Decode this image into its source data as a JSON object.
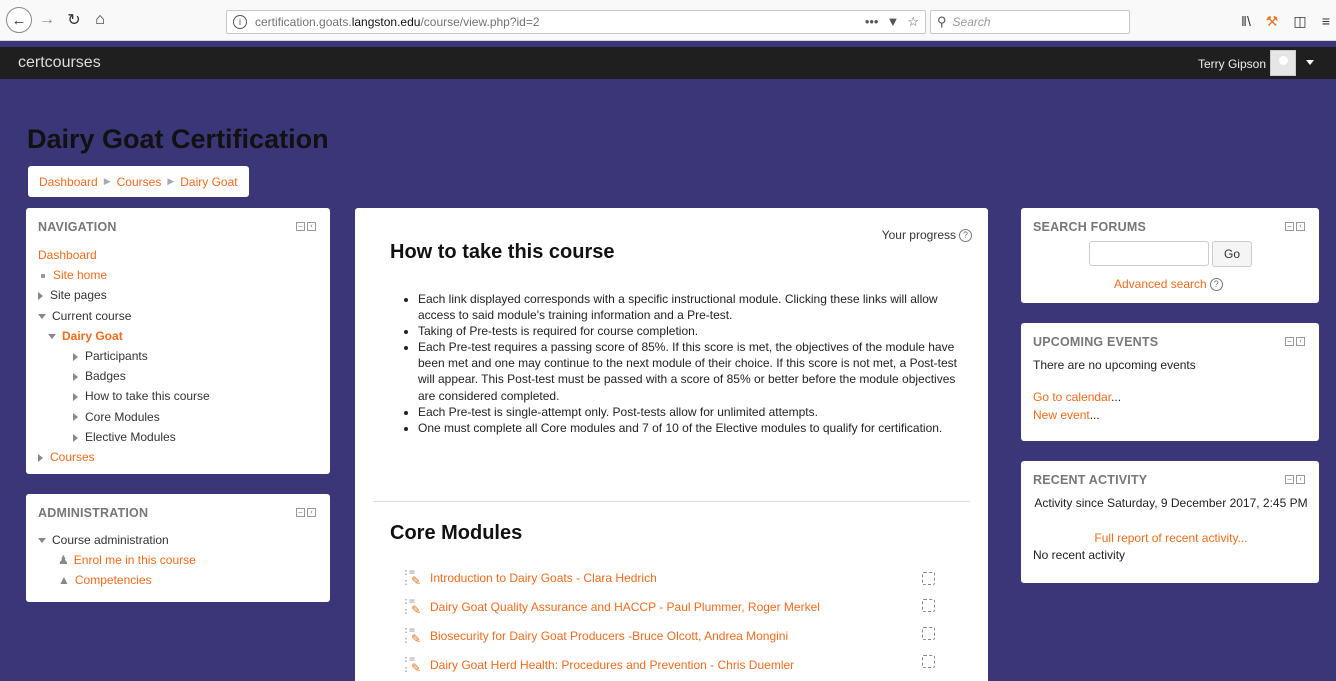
{
  "browser": {
    "url_prefix": "certification.goats.",
    "url_host": "langston.edu",
    "url_path": "/course/view.php?id=2",
    "search_placeholder": "Search",
    "more_glyph": "•••"
  },
  "site": {
    "brand": "certcourses",
    "user_name": "Terry Gipson"
  },
  "page": {
    "title": "Dairy Goat Certification",
    "breadcrumb": [
      "Dashboard",
      "Courses",
      "Dairy Goat"
    ]
  },
  "navigation": {
    "title": "NAVIGATION",
    "dashboard": "Dashboard",
    "site_home": "Site home",
    "site_pages": "Site pages",
    "current_course": "Current course",
    "course": "Dairy Goat",
    "participants": "Participants",
    "badges": "Badges",
    "how_to": "How to take this course",
    "core_modules": "Core Modules",
    "elective_modules": "Elective Modules",
    "courses": "Courses"
  },
  "administration": {
    "title": "ADMINISTRATION",
    "course_admin": "Course administration",
    "enrol": "Enrol me in this course",
    "competencies": "Competencies"
  },
  "main": {
    "your_progress": "Your progress",
    "how_to_title": "How to take this course",
    "bullets": [
      "Each link displayed corresponds with a specific instructional module. Clicking these links will allow access to said module's training information and a Pre-test.",
      "Taking of Pre-tests is required for course completion.",
      "Each Pre-test requires a passing score of 85%. If this score is met, the objectives of the module have been met and one may continue to the next module of their choice. If this score is not met, a Post-test will appear. This Post-test must be passed with a score of 85% or better before the module objectives are considered completed.",
      "Each Pre-test is single-attempt only. Post-tests allow for unlimited attempts.",
      "One must complete all Core modules and 7 of 10 of the Elective modules to qualify for certification."
    ],
    "core_title": "Core Modules",
    "modules": [
      "Introduction to Dairy Goats - Clara Hedrich",
      "Dairy Goat Quality Assurance and HACCP - Paul Plummer, Roger Merkel",
      "Biosecurity for Dairy Goat Producers -Bruce Olcott, Andrea Mongini",
      "Dairy Goat Herd Health: Procedures and Prevention - Chris Duemler"
    ]
  },
  "search_forums": {
    "title": "SEARCH FORUMS",
    "go": "Go",
    "advanced": "Advanced search"
  },
  "upcoming": {
    "title": "UPCOMING EVENTS",
    "none": "There are no upcoming events",
    "calendar": "Go to calendar",
    "new_event": "New event",
    "ellipsis": "..."
  },
  "recent": {
    "title": "RECENT ACTIVITY",
    "since": "Activity since Saturday, 9 December 2017, 2:45 PM",
    "full_report": "Full report of recent activity...",
    "none": "No recent activity"
  }
}
